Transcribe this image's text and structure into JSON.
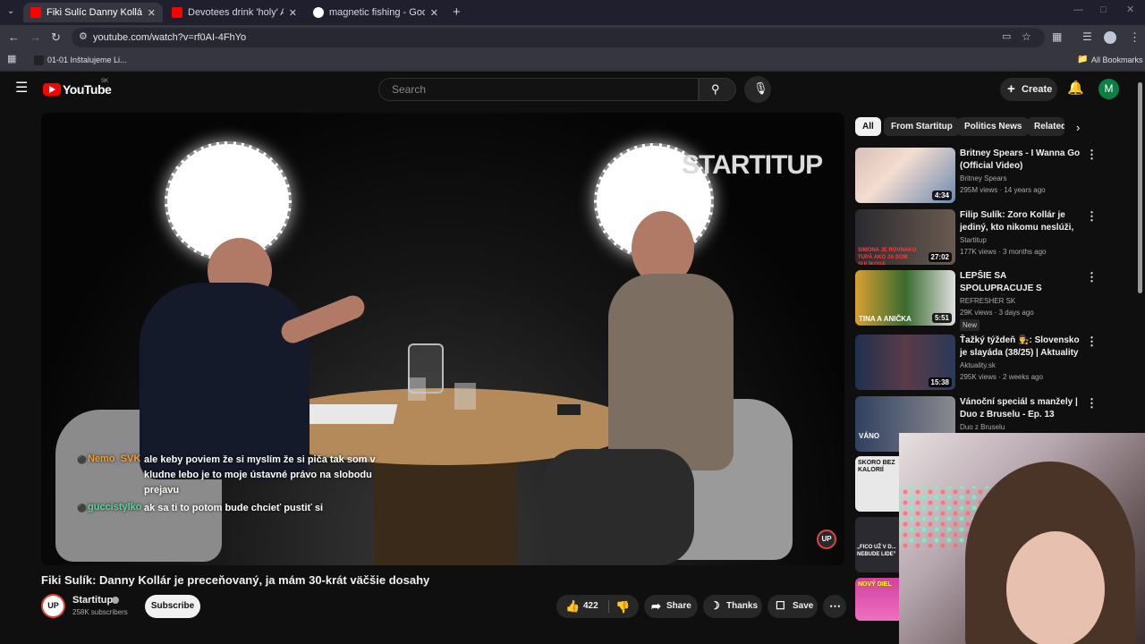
{
  "browser": {
    "tabs": [
      {
        "title": "Fiki Sulíc Danny Kollár je prece",
        "active": true,
        "favicon_color": "#ff0000"
      },
      {
        "title": "Devotees drink 'holy' AC water",
        "active": false,
        "favicon_color": "#ff0000"
      },
      {
        "title": "magnetic fishing - Google Sear",
        "active": false,
        "favicon_color": "#ffffff"
      }
    ],
    "new_tab_glyph": "+",
    "url": "youtube.com/watch?v=rf0AI-4FhYo",
    "bookmark": "01-01 Inštalujeme Li...",
    "all_bookmarks": "All Bookmarks"
  },
  "youtube": {
    "logo_text": "YouTube",
    "region": "SK",
    "search_placeholder": "Search",
    "create_label": "Create",
    "avatar_letter": "M"
  },
  "video": {
    "brand_overlay": "STARTITUP",
    "watermark": "UP",
    "chat": [
      {
        "name": "Nemo_SVK",
        "name_color": "#f0a030",
        "lines": [
          "ale keby poviem že si myslím že si piča tak som v",
          "kludne lebo je to moje ústavné právo na slobodu",
          "prejavu"
        ]
      },
      {
        "name": "guccistylko",
        "name_color": "#5fd3a0",
        "lines": [
          "ak sa ti to potom bude chcieť pustiť si"
        ]
      }
    ],
    "title": "Fiki Sulík: Danny Kollár je preceňovaný, ja mám 30-krát väčšie dosahy",
    "channel": "Startitup",
    "channel_avatar": "UP",
    "subscribers": "258K subscribers",
    "subscribe_label": "Subscribe",
    "likes": "422",
    "share_label": "Share",
    "thanks_label": "Thanks",
    "save_label": "Save"
  },
  "sidebar": {
    "chips": [
      "All",
      "From Startitup",
      "Politics News",
      "Related"
    ],
    "recommendations": [
      {
        "title": "Britney Spears - I Wanna Go (Official Video)",
        "channel": "Britney Spears",
        "verified": true,
        "meta": "295M views · 14 years ago",
        "duration": "4:34",
        "badge": ""
      },
      {
        "title": "Filip Sulík: Zoro Kollár je jediný, kto nikomu neslúži, peniaze h...",
        "channel": "Startitup",
        "verified": true,
        "meta": "177K views · 3 months ago",
        "duration": "27:02",
        "badge": ""
      },
      {
        "title": "LEPŠIE SA SPOLUPRACUJE S MAMOU, ČI TATOM? Tina a ...",
        "channel": "REFRESHER SK",
        "verified": true,
        "meta": "29K views · 3 days ago",
        "duration": "5:51",
        "badge": "New"
      },
      {
        "title": "Ťažký týždeň 👨‍⚖️: Slovensko je slayáda (38/25) | Aktuality",
        "channel": "Aktuality.sk",
        "verified": false,
        "meta": "295K views · 2 weeks ago",
        "duration": "15:38",
        "badge": ""
      },
      {
        "title": "Vánoční speciál s manžely | Duo z Bruselu - Ep. 13",
        "channel": "Duo z Bruselu",
        "verified": false,
        "meta": "",
        "duration": "",
        "badge": ""
      }
    ],
    "thumb_texts": [
      "",
      "SIMONA JE ROVNAKO TUPÁ AKO JA SOM SULÍKOVÁ",
      "TINA A ANIČKA",
      "",
      "VÁNO",
      "SKORO BEZ KALORIÍ",
      "„FICO UŽ V D... NEBUDE LIDE”",
      "NOVÝ DIEL"
    ]
  }
}
